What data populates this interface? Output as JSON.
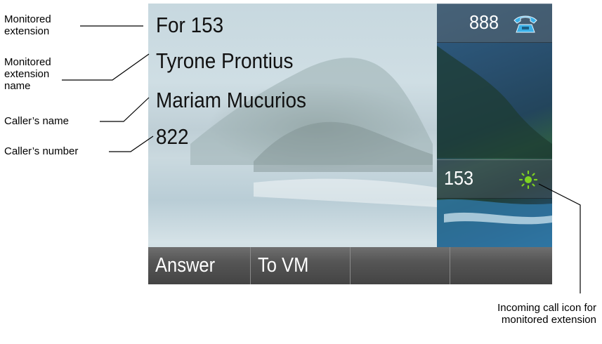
{
  "callouts": {
    "monitored_extension": "Monitored extension",
    "monitored_extension_name": "Monitored extension name",
    "callers_name": "Caller’s name",
    "callers_number": "Caller’s number",
    "incoming_call_icon": "Incoming call icon for monitored extension"
  },
  "screen": {
    "line_for": "For 153",
    "monitored_name": "Tyrone Prontius",
    "caller_name": "Mariam Mucurios",
    "caller_number": "822",
    "line_keys": [
      {
        "label": "888",
        "icon": "phone-icon",
        "icon_color": "#3ab0e8"
      },
      {
        "label": "153",
        "icon": "incoming-call-icon",
        "icon_color": "#7ed321"
      }
    ],
    "softkeys": [
      "Answer",
      "To VM",
      "",
      ""
    ]
  }
}
